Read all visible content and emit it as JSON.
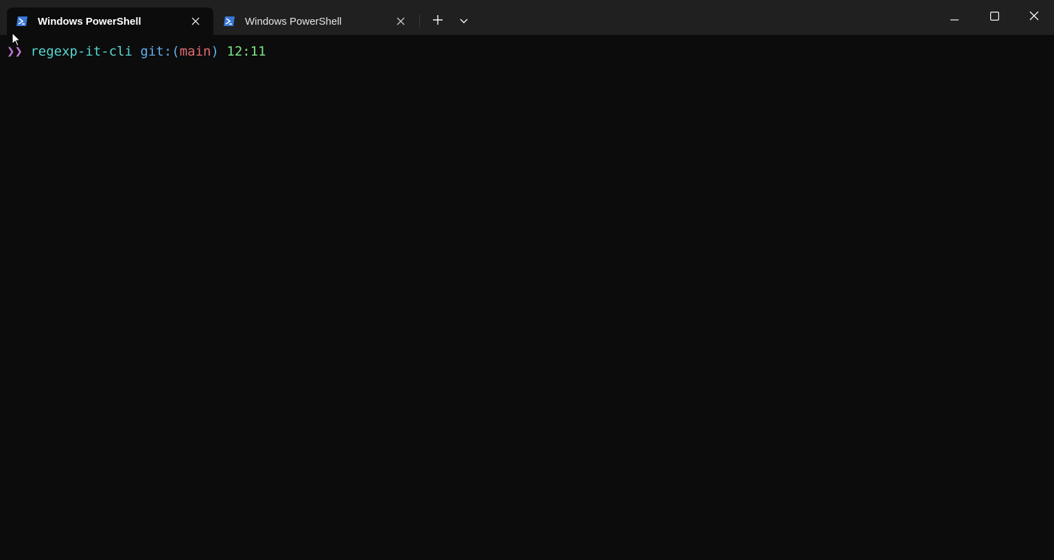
{
  "tabs": [
    {
      "title": "Windows PowerShell",
      "active": true,
      "icon": "powershell-icon"
    },
    {
      "title": "Windows PowerShell",
      "active": false,
      "icon": "powershell-icon"
    }
  ],
  "titlebar_buttons": {
    "new_tab": "plus-icon",
    "dropdown": "chevron-down-icon",
    "minimize": "minimize-icon",
    "maximize": "maximize-icon",
    "close": "close-icon"
  },
  "terminal": {
    "prompt_symbol": "❯❯",
    "directory": "regexp-it-cli",
    "git_prefix": "git:(",
    "branch": "main",
    "git_suffix": ")",
    "time": "12:11"
  },
  "colors": {
    "background": "#0c0c0c",
    "titlebar": "#202020",
    "directory": "#56d7d2",
    "git": "#61afef",
    "branch": "#e06c75",
    "time": "#7ee787",
    "powershell_icon": "#3a78d8"
  }
}
